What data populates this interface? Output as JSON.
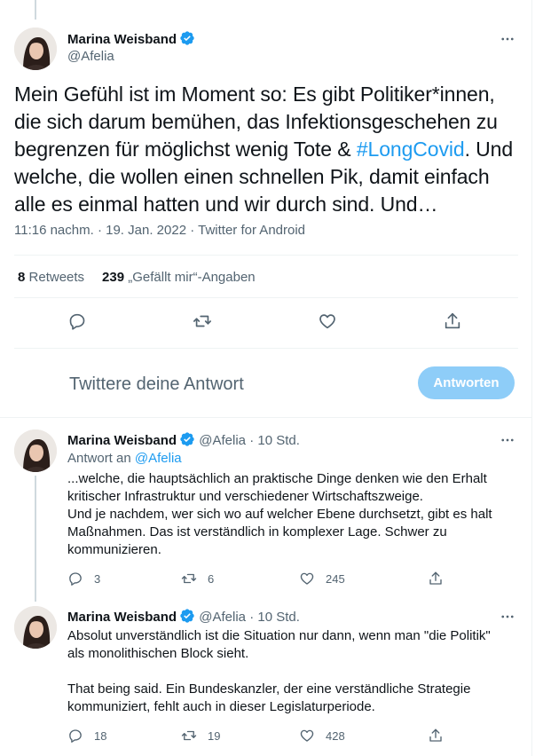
{
  "main_tweet": {
    "author_name": "Marina Weisband",
    "handle": "@Afelia",
    "text_before_tag": "Mein Gefühl ist im Moment so: Es gibt Politiker*innen, die sich darum bemühen, das Infektionsgeschehen zu begrenzen für möglichst wenig Tote & ",
    "hashtag": "#LongCovid",
    "text_after_tag": ". Und welche, die wollen einen schnellen Pik, damit einfach alle es einmal hatten und wir durch sind. Und…",
    "time": "11:16 nachm.",
    "date": "19. Jan. 2022",
    "source": "Twitter for Android",
    "retweets_count": "8",
    "retweets_label": "Retweets",
    "likes_count": "239",
    "likes_label": "„Gefällt mir“-Angaben"
  },
  "compose": {
    "placeholder": "Twittere deine Antwort",
    "button_label": "Antworten"
  },
  "replies": [
    {
      "author_name": "Marina Weisband",
      "handle": "@Afelia",
      "time": "10 Std.",
      "reply_to_prefix": "Antwort an ",
      "reply_to_handle": "@Afelia",
      "text": "...welche, die hauptsächlich an praktische Dinge denken wie den Erhalt kritischer Infrastruktur und verschiedener Wirtschaftszweige.\nUnd je nachdem, wer sich wo auf welcher Ebene durchsetzt, gibt es halt Maßnahmen. Das ist  verständlich in komplexer Lage. Schwer zu kommunizieren.",
      "replies": "3",
      "retweets": "6",
      "likes": "245"
    },
    {
      "author_name": "Marina Weisband",
      "handle": "@Afelia",
      "time": "10 Std.",
      "text": "Absolut unverständlich ist die Situation nur dann, wenn man \"die Politik\" als monolithischen Block sieht.\n\nThat being said. Ein Bundeskanzler, der eine verständliche Strategie kommuniziert, fehlt auch in dieser Legislaturperiode.",
      "replies": "18",
      "retweets": "19",
      "likes": "428"
    }
  ],
  "separator_dot": "·",
  "icons": [
    "verified-badge-icon",
    "more-icon",
    "reply-icon",
    "retweet-icon",
    "like-icon",
    "share-icon"
  ],
  "colors": {
    "accent": "#1d9bf0",
    "button_disabled": "#8ecdf8",
    "text": "#0f1419",
    "muted": "#536471",
    "border": "#eff3f4"
  }
}
